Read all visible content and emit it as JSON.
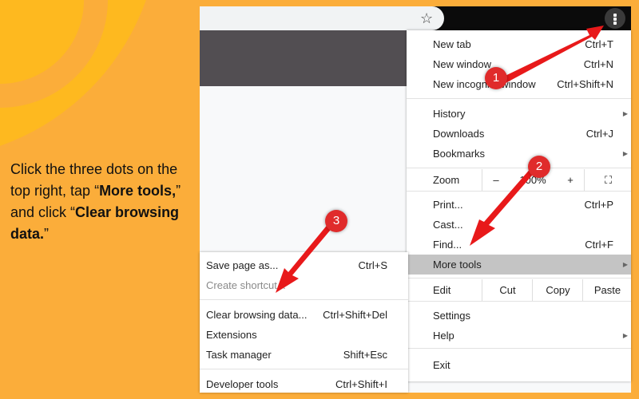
{
  "instruction": {
    "part1": "Click the three dots on the top right, tap “",
    "bold1": "More tools,",
    "part2": "” and click “",
    "bold2": "Clear browsing data.",
    "part3": "”"
  },
  "browser": {
    "bookmark_icon": "star-icon",
    "menu_icon": "three-dots-vertical-icon"
  },
  "main_menu": {
    "items": [
      {
        "label": "New tab",
        "shortcut": "Ctrl+T"
      },
      {
        "label": "New window",
        "shortcut": "Ctrl+N"
      },
      {
        "label": "New incognito window",
        "shortcut": "Ctrl+Shift+N"
      },
      {
        "label": "History",
        "submenu": true
      },
      {
        "label": "Downloads",
        "shortcut": "Ctrl+J"
      },
      {
        "label": "Bookmarks",
        "submenu": true
      },
      {
        "label": "Print...",
        "shortcut": "Ctrl+P"
      },
      {
        "label": "Cast..."
      },
      {
        "label": "Find...",
        "shortcut": "Ctrl+F"
      },
      {
        "label": "More tools",
        "submenu": true,
        "highlighted": true
      },
      {
        "label": "Settings"
      },
      {
        "label": "Help",
        "submenu": true
      },
      {
        "label": "Exit"
      }
    ],
    "zoom": {
      "label": "Zoom",
      "minus": "–",
      "value": "100%",
      "plus": "+",
      "fullscreen_icon": "fullscreen-icon"
    },
    "edit": {
      "label": "Edit",
      "cut": "Cut",
      "copy": "Copy",
      "paste": "Paste"
    }
  },
  "more_tools_submenu": {
    "items": [
      {
        "label": "Save page as...",
        "shortcut": "Ctrl+S"
      },
      {
        "label": "Create shortcut...",
        "disabled": true
      },
      {
        "label": "Clear browsing data...",
        "shortcut": "Ctrl+Shift+Del"
      },
      {
        "label": "Extensions"
      },
      {
        "label": "Task manager",
        "shortcut": "Shift+Esc"
      },
      {
        "label": "Developer tools",
        "shortcut": "Ctrl+Shift+I"
      }
    ]
  },
  "annotations": {
    "badges": [
      "1",
      "2",
      "3"
    ],
    "color": "#e02b2b"
  }
}
